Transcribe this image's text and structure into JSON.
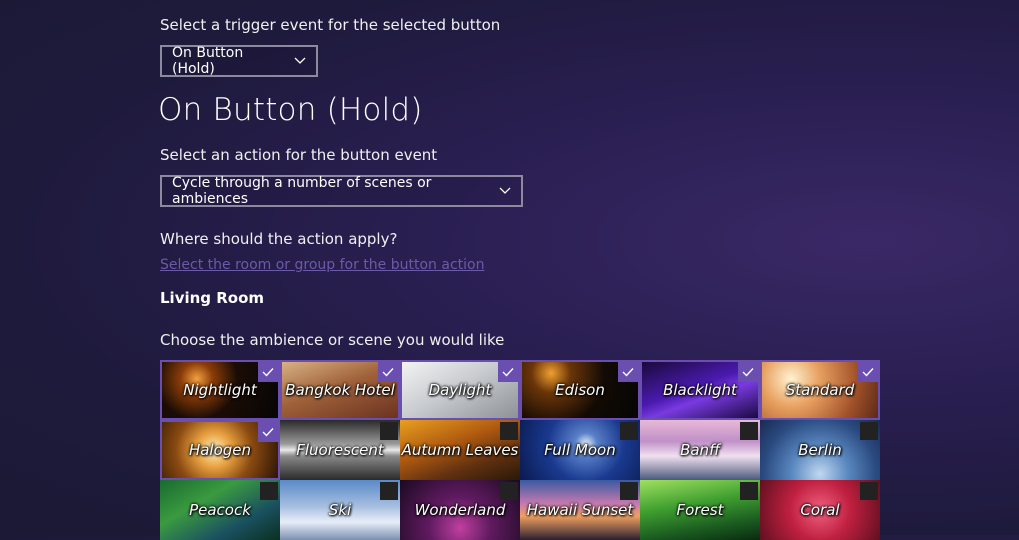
{
  "trigger": {
    "label": "Select a trigger event for the selected button",
    "selected": "On Button (Hold)"
  },
  "heading": "On Button (Hold)",
  "action": {
    "label": "Select an action for the button event",
    "selected": "Cycle through a number of scenes or ambiences"
  },
  "apply": {
    "label": "Where should the action apply?",
    "link": "Select the room or group for the button action",
    "room": "Living Room"
  },
  "scenes": {
    "label": "Choose the ambience or scene you would like",
    "accent": "#6a4fb0",
    "items": [
      {
        "name": "Nightlight",
        "checked": true,
        "bg": "radial-gradient(circle at 30% 30%, #f4a040 0%, #8a3c08 18%, #1a0c05 45%, #050505 100%)"
      },
      {
        "name": "Bangkok Hotel",
        "checked": true,
        "bg": "linear-gradient(160deg, #d9b184 0%, #a0623a 45%, #6b3220 100%)"
      },
      {
        "name": "Daylight",
        "checked": true,
        "bg": "linear-gradient(150deg, #f3f3f3 0%, #c9ccd0 45%, #8d9296 100%)"
      },
      {
        "name": "Edison",
        "checked": true,
        "bg": "radial-gradient(circle at 25% 20%, #f0a030 0%, #6b3508 20%, #120a04 55%, #050505 100%)"
      },
      {
        "name": "Blacklight",
        "checked": true,
        "bg": "linear-gradient(160deg, #1a0a3a 0%, #4a1ab0 45%, #7a3ae0 60%, #1a0a40 100%)"
      },
      {
        "name": "Standard",
        "checked": true,
        "bg": "radial-gradient(circle at 25% 30%, #fff2d0 0%, #e8a060 30%, #a05028 70%, #5a2a18 100%)"
      },
      {
        "name": "Halogen",
        "checked": true,
        "bg": "radial-gradient(circle at 45% 50%, #fff0c0 0%, #e8a040 25%, #8a4a10 55%, #2a1505 100%)"
      },
      {
        "name": "Fluorescent",
        "checked": false,
        "bg": "linear-gradient(180deg, #2a2a2a 0%, #9a9a9a 40%, #eaeaea 50%, #8a8a8a 60%, #2a2a2a 100%)"
      },
      {
        "name": "Autumn Leaves",
        "checked": false,
        "bg": "linear-gradient(160deg, #e8a020 0%, #b05a10 40%, #603010 70%, #2a1808 100%)"
      },
      {
        "name": "Full Moon",
        "checked": false,
        "bg": "radial-gradient(circle at 55% 40%, #e8eef8 0%, #5a80c8 15%, #1a3a90 50%, #0a1a50 100%)"
      },
      {
        "name": "Banff",
        "checked": false,
        "bg": "linear-gradient(180deg, #e8b8d8 0%, #c090c8 35%, #f0e0f0 60%, #4a5a7a 100%)"
      },
      {
        "name": "Berlin",
        "checked": false,
        "bg": "radial-gradient(circle at 50% 90%, #c0d8f0 0%, #5a88c0 35%, #2a4a80 70%, #1a2a50 100%)"
      },
      {
        "name": "Peacock",
        "checked": false,
        "bg": "linear-gradient(150deg, #1a6a30 0%, #3a9a40 35%, #1a5060 70%, #0a3020 100%)"
      },
      {
        "name": "Ski",
        "checked": false,
        "bg": "linear-gradient(180deg, #5a8ac8 0%, #a8c0e0 45%, #e8eef8 70%, #7a90b0 100%)"
      },
      {
        "name": "Wonderland",
        "checked": false,
        "bg": "radial-gradient(circle at 50% 80%, #c040a0 0%, #601a60 40%, #1a0a20 100%)"
      },
      {
        "name": "Hawaii Sunset",
        "checked": false,
        "bg": "linear-gradient(180deg, #3a5aa0 0%, #c87ab0 40%, #f0a060 60%, #2a2030 100%)"
      },
      {
        "name": "Forest",
        "checked": false,
        "bg": "linear-gradient(170deg, #a0e060 0%, #40a030 40%, #1a5a20 75%, #0a2a10 100%)"
      },
      {
        "name": "Coral",
        "checked": false,
        "bg": "radial-gradient(circle at 50% 50%, #f06080 0%, #c02040 45%, #601020 100%)"
      }
    ]
  }
}
